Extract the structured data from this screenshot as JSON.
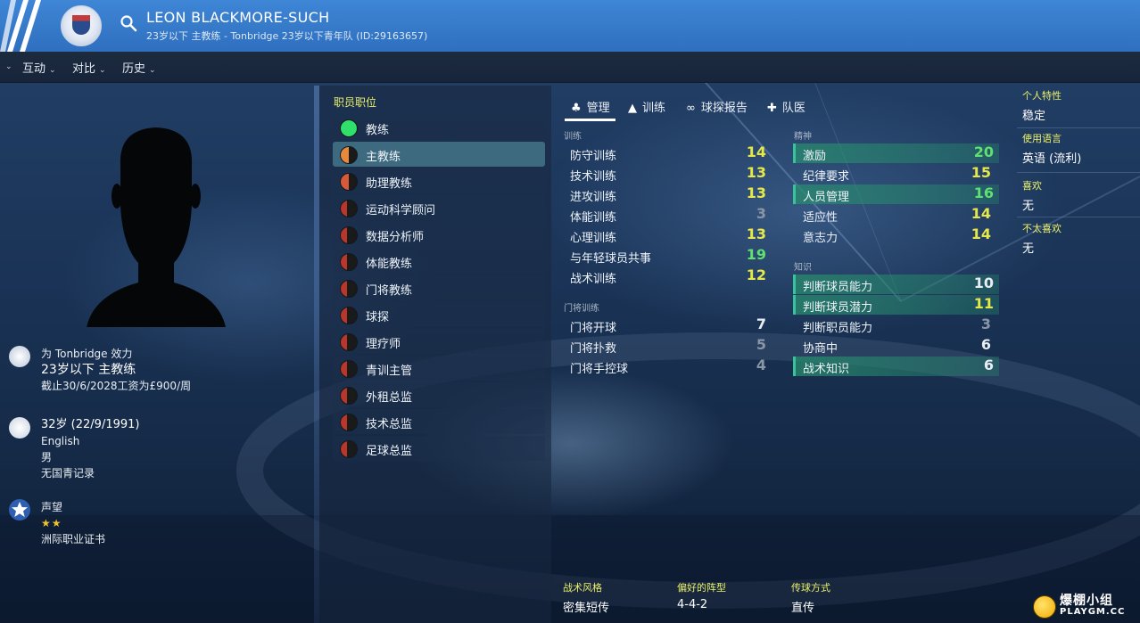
{
  "header": {
    "player_name": "LEON BLACKMORE-SUCH",
    "subtitle": "23岁以下 主教练 - Tonbridge 23岁以下青年队 (ID:29163657)"
  },
  "menu": [
    {
      "label": "互动"
    },
    {
      "label": "对比"
    },
    {
      "label": "历史"
    }
  ],
  "profile": {
    "club_line": "为 Tonbridge 效力",
    "role_line": "23岁以下 主教练",
    "contract_line": "截止30/6/2028工资为£900/周",
    "age_line": "32岁 (22/9/1991)",
    "nationality": "English",
    "gender": "男",
    "youth_record": "无国青记录",
    "reputation_label": "声望",
    "reputation_stars": "★★",
    "license": "洲际职业证书"
  },
  "roles": {
    "title": "职员职位",
    "items": [
      {
        "label": "教练",
        "dot": "#2fe06a"
      },
      {
        "label": "主教练",
        "dot": "#e88a3c"
      },
      {
        "label": "助理教练",
        "dot": "#d65a3a"
      },
      {
        "label": "运动科学顾问",
        "dot": "#b8362a"
      },
      {
        "label": "数据分析师",
        "dot": "#b8362a"
      },
      {
        "label": "体能教练",
        "dot": "#b8362a"
      },
      {
        "label": "门将教练",
        "dot": "#b8362a"
      },
      {
        "label": "球探",
        "dot": "#b8362a"
      },
      {
        "label": "理疗师",
        "dot": "#b8362a"
      },
      {
        "label": "青训主管",
        "dot": "#b8362a"
      },
      {
        "label": "外租总监",
        "dot": "#b8362a"
      },
      {
        "label": "技术总监",
        "dot": "#b8362a"
      },
      {
        "label": "足球总监",
        "dot": "#b8362a"
      }
    ]
  },
  "tabs": [
    {
      "label": "管理",
      "icon": "manage-icon"
    },
    {
      "label": "训练",
      "icon": "training-icon"
    },
    {
      "label": "球探报告",
      "icon": "binoculars-icon"
    },
    {
      "label": "队医",
      "icon": "medical-icon"
    }
  ],
  "attributes": {
    "training_label": "训练",
    "training": [
      {
        "name": "防守训练",
        "value": "14",
        "color": "#e6e84a"
      },
      {
        "name": "技术训练",
        "value": "13",
        "color": "#e6e84a"
      },
      {
        "name": "进攻训练",
        "value": "13",
        "color": "#e6e84a"
      },
      {
        "name": "体能训练",
        "value": "3",
        "color": "#8a96a6"
      },
      {
        "name": "心理训练",
        "value": "13",
        "color": "#e6e84a"
      },
      {
        "name": "与年轻球员共事",
        "value": "19",
        "color": "#5fe070"
      },
      {
        "name": "战术训练",
        "value": "12",
        "color": "#e6e84a"
      }
    ],
    "gk_label": "门将训练",
    "gk": [
      {
        "name": "门将开球",
        "value": "7",
        "color": "#e8edf3"
      },
      {
        "name": "门将扑救",
        "value": "5",
        "color": "#8a96a6"
      },
      {
        "name": "门将手控球",
        "value": "4",
        "color": "#8a96a6"
      }
    ],
    "mental_label": "精神",
    "mental": [
      {
        "name": "激励",
        "value": "20",
        "color": "#5fe070",
        "hl": true
      },
      {
        "name": "纪律要求",
        "value": "15",
        "color": "#e6e84a",
        "hl": false
      },
      {
        "name": "人员管理",
        "value": "16",
        "color": "#5fe070",
        "hl": true
      },
      {
        "name": "适应性",
        "value": "14",
        "color": "#e6e84a",
        "hl": false
      },
      {
        "name": "意志力",
        "value": "14",
        "color": "#e6e84a",
        "hl": false
      }
    ],
    "knowledge_label": "知识",
    "knowledge": [
      {
        "name": "判断球员能力",
        "value": "10",
        "color": "#e8edf3",
        "hl": true
      },
      {
        "name": "判断球员潜力",
        "value": "11",
        "color": "#e6e84a",
        "hl": true
      },
      {
        "name": "判断职员能力",
        "value": "3",
        "color": "#8a96a6",
        "hl": false
      },
      {
        "name": "协商中",
        "value": "6",
        "color": "#e8edf3",
        "hl": false
      },
      {
        "name": "战术知识",
        "value": "6",
        "color": "#e8edf3",
        "hl": true
      }
    ]
  },
  "side": {
    "personality_label": "个人特性",
    "personality": "稳定",
    "language_label": "使用语言",
    "language": "英语 (流利)",
    "likes_label": "喜欢",
    "likes": "无",
    "dislikes_label": "不太喜欢",
    "dislikes": "无"
  },
  "tactics": {
    "style_label": "战术风格",
    "style": "密集短传",
    "formation_label": "偏好的阵型",
    "formation": "4-4-2",
    "passing_label": "传球方式",
    "passing": "直传"
  },
  "watermark": {
    "line1": "爆棚小组",
    "line2": "PLAYGM.CC"
  }
}
